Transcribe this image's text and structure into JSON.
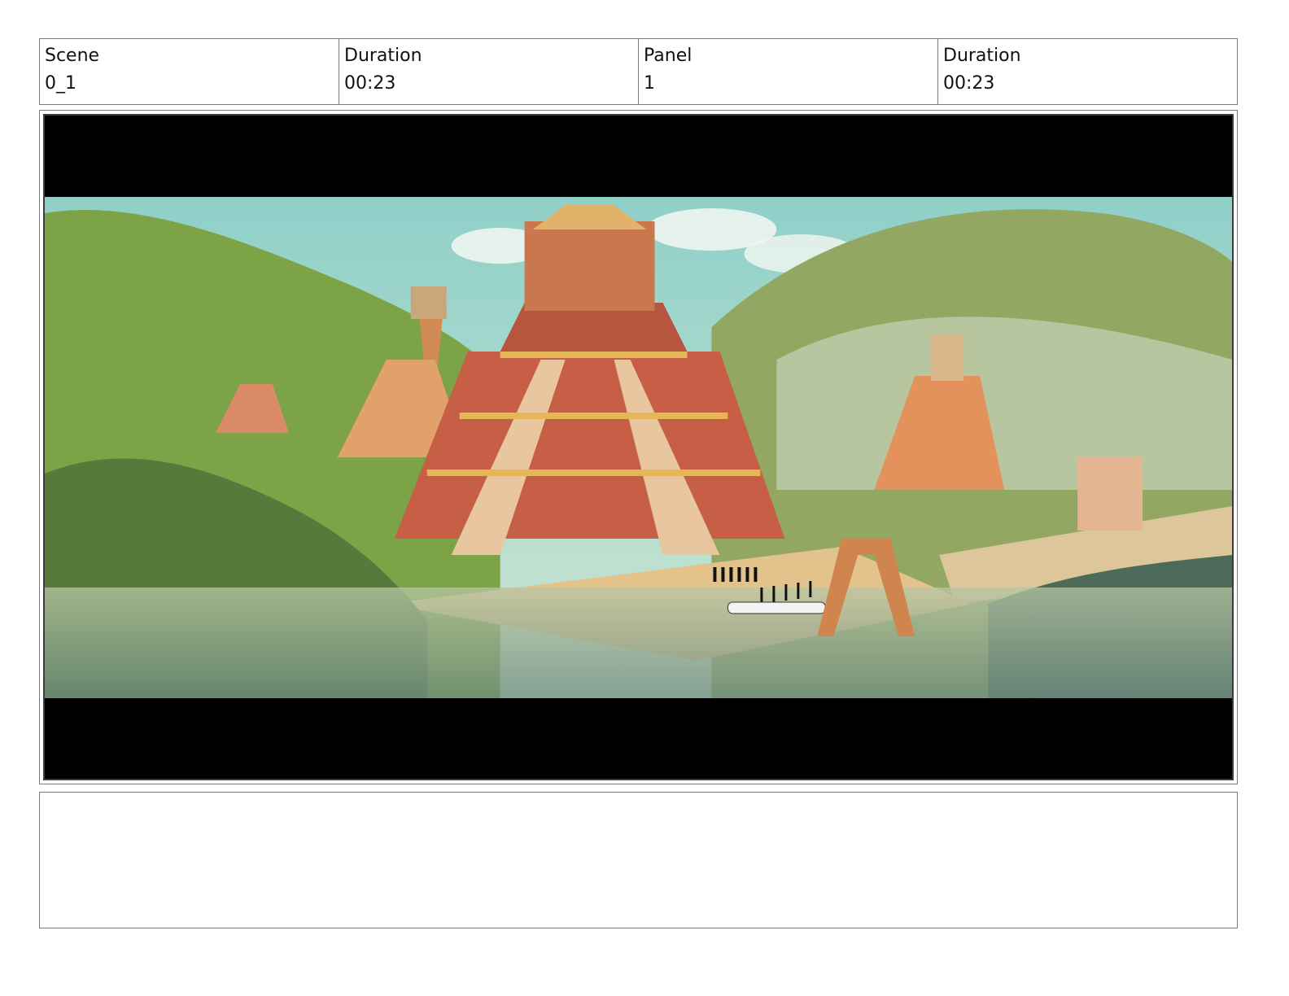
{
  "header": {
    "scene_label": "Scene",
    "scene_value": "0_1",
    "scene_duration_label": "Duration",
    "scene_duration_value": "00:23",
    "panel_label": "Panel",
    "panel_value": "1",
    "panel_duration_label": "Duration",
    "panel_duration_value": "00:23"
  },
  "notes": {
    "text": ""
  },
  "colors": {
    "sky": "#9fd3cc",
    "hills": "#7ea24a",
    "temple": "#c6664a",
    "sand": "#e6c48e",
    "mist": "#d8e2d2"
  }
}
